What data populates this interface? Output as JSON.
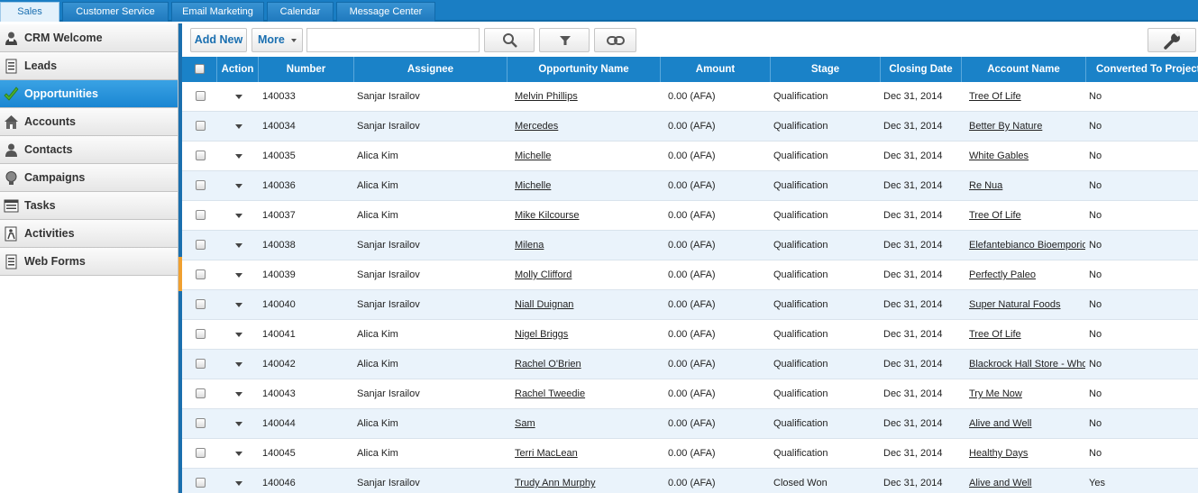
{
  "top_tabs": [
    {
      "label": "Sales",
      "active": true
    },
    {
      "label": "Customer Service"
    },
    {
      "label": "Email Marketing"
    },
    {
      "label": "Calendar"
    },
    {
      "label": "Message Center"
    }
  ],
  "sidebar": {
    "items": [
      {
        "label": "CRM Welcome",
        "icon": "person-icon"
      },
      {
        "label": "Leads",
        "icon": "document-list-icon"
      },
      {
        "label": "Opportunities",
        "icon": "checkmark-icon",
        "active": true
      },
      {
        "label": "Accounts",
        "icon": "building-icon"
      },
      {
        "label": "Contacts",
        "icon": "contact-icon"
      },
      {
        "label": "Campaigns",
        "icon": "campaign-icon"
      },
      {
        "label": "Tasks",
        "icon": "task-list-icon"
      },
      {
        "label": "Activities",
        "icon": "activity-icon"
      },
      {
        "label": "Web Forms",
        "icon": "web-form-icon"
      }
    ]
  },
  "toolbar": {
    "add_new_label": "Add New",
    "more_label": "More",
    "search_value": "",
    "search_icon": "magnifier-icon",
    "filter_icon": "funnel-icon",
    "link_icon": "chain-link-icon",
    "settings_icon": "wrench-icon"
  },
  "grid": {
    "columns": [
      "",
      "Action",
      "Number",
      "Assignee",
      "Opportunity Name",
      "Amount",
      "Stage",
      "Closing Date",
      "Account Name",
      "Converted To Project"
    ],
    "rows": [
      {
        "number": "140033",
        "assignee": "Sanjar Israilov",
        "opportunity": "Melvin Phillips",
        "amount": "0.00 (AFA)",
        "stage": "Qualification",
        "closing": "Dec 31, 2014",
        "account": "Tree Of Life",
        "converted": "No"
      },
      {
        "number": "140034",
        "assignee": "Sanjar Israilov",
        "opportunity": "Mercedes",
        "amount": "0.00 (AFA)",
        "stage": "Qualification",
        "closing": "Dec 31, 2014",
        "account": "Better By Nature",
        "converted": "No"
      },
      {
        "number": "140035",
        "assignee": "Alica Kim",
        "opportunity": "Michelle",
        "amount": "0.00 (AFA)",
        "stage": "Qualification",
        "closing": "Dec 31, 2014",
        "account": "White Gables",
        "converted": "No"
      },
      {
        "number": "140036",
        "assignee": "Alica Kim",
        "opportunity": "Michelle",
        "amount": "0.00 (AFA)",
        "stage": "Qualification",
        "closing": "Dec 31, 2014",
        "account": "Re Nua",
        "converted": "No"
      },
      {
        "number": "140037",
        "assignee": "Alica Kim",
        "opportunity": "Mike Kilcourse",
        "amount": "0.00 (AFA)",
        "stage": "Qualification",
        "closing": "Dec 31, 2014",
        "account": "Tree Of Life",
        "converted": "No"
      },
      {
        "number": "140038",
        "assignee": "Sanjar Israilov",
        "opportunity": "Milena",
        "amount": "0.00 (AFA)",
        "stage": "Qualification",
        "closing": "Dec 31, 2014",
        "account": "Elefantebianco Bioemporio",
        "converted": "No"
      },
      {
        "number": "140039",
        "assignee": "Sanjar Israilov",
        "opportunity": "Molly Clifford",
        "amount": "0.00 (AFA)",
        "stage": "Qualification",
        "closing": "Dec 31, 2014",
        "account": "Perfectly Paleo",
        "converted": "No"
      },
      {
        "number": "140040",
        "assignee": "Sanjar Israilov",
        "opportunity": "Niall Duignan",
        "amount": "0.00 (AFA)",
        "stage": "Qualification",
        "closing": "Dec 31, 2014",
        "account": "Super Natural Foods",
        "converted": "No"
      },
      {
        "number": "140041",
        "assignee": "Alica Kim",
        "opportunity": "Nigel Briggs",
        "amount": "0.00 (AFA)",
        "stage": "Qualification",
        "closing": "Dec 31, 2014",
        "account": "Tree Of Life",
        "converted": "No"
      },
      {
        "number": "140042",
        "assignee": "Alica Kim",
        "opportunity": "Rachel O'Brien",
        "amount": "0.00 (AFA)",
        "stage": "Qualification",
        "closing": "Dec 31, 2014",
        "account": "Blackrock Hall Store - Whole",
        "converted": "No"
      },
      {
        "number": "140043",
        "assignee": "Sanjar Israilov",
        "opportunity": "Rachel Tweedie",
        "amount": "0.00 (AFA)",
        "stage": "Qualification",
        "closing": "Dec 31, 2014",
        "account": "Try Me Now",
        "converted": "No"
      },
      {
        "number": "140044",
        "assignee": "Alica Kim",
        "opportunity": "Sam",
        "amount": "0.00 (AFA)",
        "stage": "Qualification",
        "closing": "Dec 31, 2014",
        "account": "Alive and Well",
        "converted": "No"
      },
      {
        "number": "140045",
        "assignee": "Alica Kim",
        "opportunity": "Terri MacLean",
        "amount": "0.00 (AFA)",
        "stage": "Qualification",
        "closing": "Dec 31, 2014",
        "account": "Healthy Days",
        "converted": "No"
      },
      {
        "number": "140046",
        "assignee": "Sanjar Israilov",
        "opportunity": "Trudy Ann Murphy",
        "amount": "0.00 (AFA)",
        "stage": "Closed Won",
        "closing": "Dec 31, 2014",
        "account": "Alive and Well",
        "converted": "Yes"
      }
    ]
  }
}
